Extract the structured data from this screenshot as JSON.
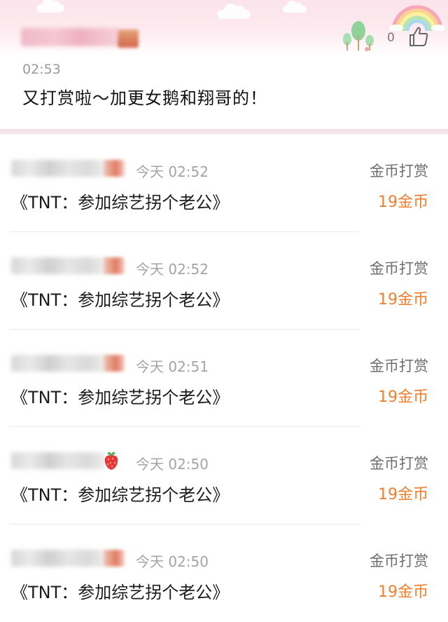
{
  "post": {
    "like_count": "0",
    "time": "02:53",
    "text": "又打赏啦～加更女鹅和翔哥的！"
  },
  "rewards": [
    {
      "time": "今天 02:52",
      "type": "金币打赏",
      "book": "《TNT：参加综艺拐个老公》",
      "amount": "19金币"
    },
    {
      "time": "今天 02:52",
      "type": "金币打赏",
      "book": "《TNT：参加综艺拐个老公》",
      "amount": "19金币"
    },
    {
      "time": "今天 02:51",
      "type": "金币打赏",
      "book": "《TNT：参加综艺拐个老公》",
      "amount": "19金币"
    },
    {
      "time": "今天 02:50",
      "type": "金币打赏",
      "book": "《TNT：参加综艺拐个老公》",
      "amount": "19金币"
    },
    {
      "time": "今天 02:50",
      "type": "金币打赏",
      "book": "《TNT：参加综艺拐个老公》",
      "amount": "19金币"
    }
  ],
  "icons": {
    "like": "thumbs-up-icon",
    "trees": "tree-icon",
    "rainbow": "rainbow-icon",
    "badge": "strawberry-icon"
  },
  "colors": {
    "accent_amount": "#f08030",
    "header_pink": "#fce3ec"
  }
}
